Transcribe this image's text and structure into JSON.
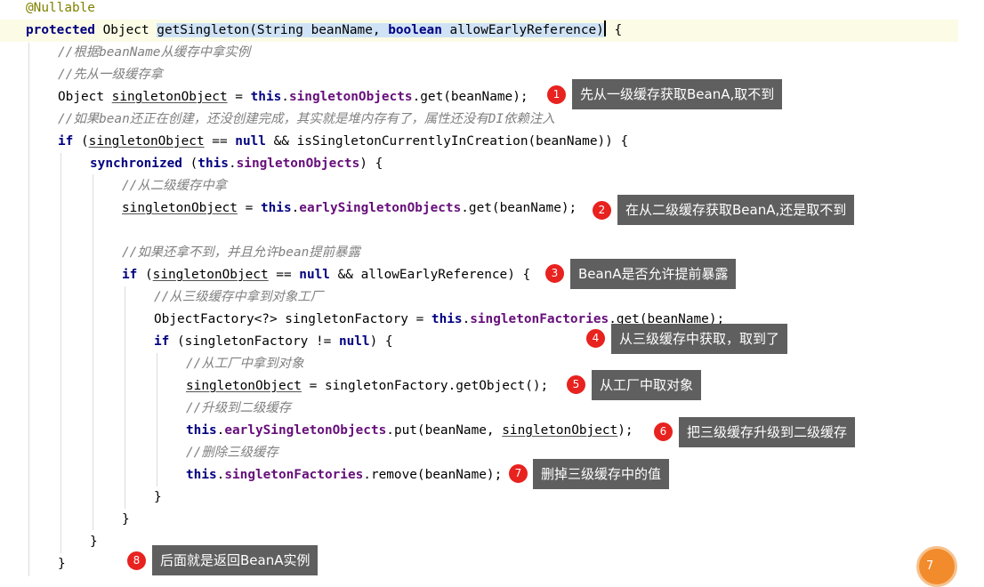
{
  "code": {
    "annotation": "@Nullable",
    "signature": {
      "kw_protected": "protected",
      "return_type": " Object ",
      "method": "getSingleton",
      "p1": "(String beanName, ",
      "kw_boolean": "boolean",
      "p2": " allowEarlyReference)",
      "open": " {"
    },
    "c1": "//根据beanName从缓存中拿实例",
    "c2": "//先从一级缓存拿",
    "l5": {
      "a": "Object ",
      "var": "singletonObject",
      "b": " = ",
      "kw_this": "this",
      "dot": ".",
      "field": "singletonObjects",
      "c": ".get(beanName);"
    },
    "c3": "//如果bean还正在创建，还没创建完成，其实就是堆内存有了，属性还没有DI依赖注入",
    "l7": {
      "kw_if": "if",
      "a": " (",
      "var": "singletonObject",
      "b": " == ",
      "kw_null": "null",
      "c": " && isSingletonCurrentlyInCreation(beanName)) {"
    },
    "l8": {
      "kw_sync": "synchronized",
      "a": " (",
      "kw_this": "this",
      "dot": ".",
      "field": "singletonObjects",
      "b": ") {"
    },
    "c4": "//从二级缓存中拿",
    "l10": {
      "var": "singletonObject",
      "a": " = ",
      "kw_this": "this",
      "dot": ".",
      "field": "earlySingletonObjects",
      "b": ".get(beanName);"
    },
    "c5": "//如果还拿不到，并且允许bean提前暴露",
    "l13": {
      "kw_if": "if",
      "a": " (",
      "var": "singletonObject",
      "b": " == ",
      "kw_null": "null",
      "c": " && allowEarlyReference) {"
    },
    "c6": "//从三级缓存中拿到对象工厂",
    "l15": {
      "a": "ObjectFactory<?> singletonFactory = ",
      "kw_this": "this",
      "dot": ".",
      "field": "singletonFactories",
      "b": ".get(beanName);"
    },
    "l16": {
      "kw_if": "if",
      "a": " (singletonFactory != ",
      "kw_null": "null",
      "b": ") {"
    },
    "c7": "//从工厂中拿到对象",
    "l18": {
      "var": "singletonObject",
      "a": " = singletonFactory.getObject();"
    },
    "c8": "//升级到二级缓存",
    "l20": {
      "kw_this": "this",
      "dot": ".",
      "field": "earlySingletonObjects",
      "a": ".put(beanName, ",
      "var": "singletonObject",
      "b": ");"
    },
    "c9": "//删除三级缓存",
    "l22": {
      "kw_this": "this",
      "dot": ".",
      "field": "singletonFactories",
      "a": ".remove(beanName);"
    },
    "close": "}"
  },
  "callouts": [
    {
      "num": "1",
      "text": "先从一级缓存获取BeanA,取不到"
    },
    {
      "num": "2",
      "text": "在从二级缓存获取BeanA,还是取不到"
    },
    {
      "num": "3",
      "text": "BeanA是否允许提前暴露"
    },
    {
      "num": "4",
      "text": "从三级缓存中获取，取到了"
    },
    {
      "num": "5",
      "text": "从工厂中取对象"
    },
    {
      "num": "6",
      "text": "把三级缓存升级到二级缓存"
    },
    {
      "num": "7",
      "text": "删掉三级缓存中的值"
    },
    {
      "num": "8",
      "text": "后面就是返回BeanA实例"
    }
  ],
  "corner_badge": "7",
  "colors": {
    "keyword": "#000080",
    "field": "#660e7a",
    "comment": "#808080",
    "annotation": "#808000",
    "callout_bg": "#5f5f5f",
    "badge": "#e8221f"
  }
}
